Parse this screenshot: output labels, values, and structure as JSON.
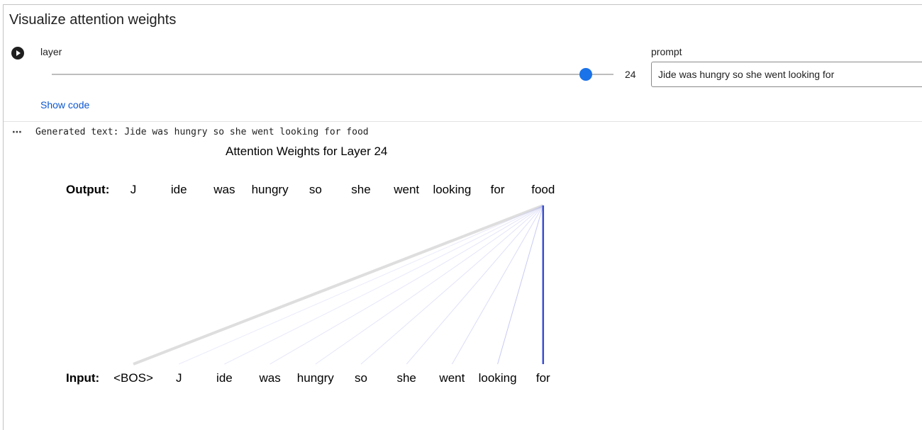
{
  "form": {
    "title": "Visualize attention weights",
    "layer_label": "layer",
    "layer_value": 24,
    "layer_display": "24",
    "layer_fraction": 0.96,
    "prompt_label": "prompt",
    "prompt_value": "Jide was hungry so she went looking for",
    "show_code": "Show code"
  },
  "output": {
    "menu_glyph": "⋯",
    "generated_text": "Generated text: Jide was hungry so she went looking for food"
  },
  "visualization": {
    "title": "Attention Weights for Layer 24",
    "output_label": "Output:",
    "input_label": "Input:",
    "output_tokens": [
      "J",
      "ide",
      "was",
      "hungry",
      "so",
      "she",
      "went",
      "looking",
      "for",
      "food"
    ],
    "input_tokens": [
      "<BOS>",
      "J",
      "ide",
      "was",
      "hungry",
      "so",
      "she",
      "went",
      "looking",
      "for"
    ],
    "attended_output_token": "food",
    "attention_weights": [
      0.35,
      0.02,
      0.03,
      0.04,
      0.04,
      0.05,
      0.07,
      0.09,
      0.18,
      1.0
    ],
    "line_colors": {
      "bos": "#dadada",
      "default": "#b8bcf0",
      "strong": "#3a4fd0"
    }
  }
}
